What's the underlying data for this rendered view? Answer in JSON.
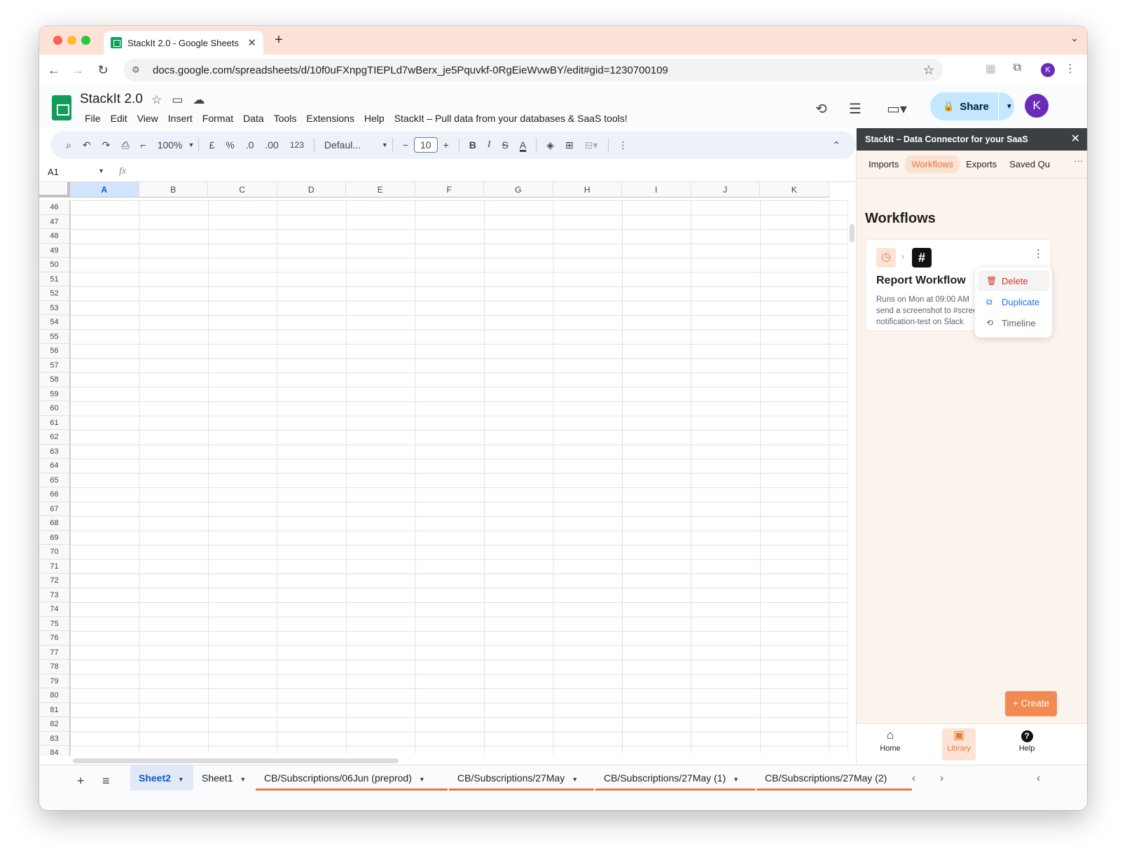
{
  "browser": {
    "tab_title": "StackIt 2.0 - Google Sheets",
    "url": "docs.google.com/spreadsheets/d/10f0uFXnpgTIEPLd7wBerx_je5Pquvkf-0RgEieWvwBY/edit#gid=1230700109",
    "profile_initial": "K"
  },
  "doc": {
    "title": "StackIt 2.0",
    "menu": [
      "File",
      "Edit",
      "View",
      "Insert",
      "Format",
      "Data",
      "Tools",
      "Extensions",
      "Help",
      "StackIt – Pull data from your databases & SaaS tools!"
    ],
    "share_label": "Share",
    "avatar_initial": "K"
  },
  "toolbar": {
    "zoom": "100%",
    "currency": "£",
    "percent": "%",
    "decrease_decimals": ".0",
    "increase_decimals": ".00",
    "number_format": "123",
    "font": "Defaul...",
    "font_size": "10",
    "bold": "B",
    "italic": "I",
    "strike": "S",
    "text_color": "A"
  },
  "formula": {
    "cell_ref": "A1",
    "fx": "fx"
  },
  "grid": {
    "columns": [
      "A",
      "B",
      "C",
      "D",
      "E",
      "F",
      "G",
      "H",
      "I",
      "J",
      "K"
    ],
    "active_column": "A",
    "rows": [
      46,
      47,
      48,
      49,
      50,
      51,
      52,
      53,
      54,
      55,
      56,
      57,
      58,
      59,
      60,
      61,
      62,
      63,
      64,
      65,
      66,
      67,
      68,
      69,
      70,
      71,
      72,
      73,
      74,
      75,
      76,
      77,
      78,
      79,
      80,
      81,
      82,
      83,
      84
    ]
  },
  "sheet_tabs": [
    {
      "label": "Sheet2",
      "active": true,
      "colored": false
    },
    {
      "label": "Sheet1",
      "active": false,
      "colored": false
    },
    {
      "label": "CB/Subscriptions/06Jun (preprod)",
      "active": false,
      "colored": true
    },
    {
      "label": "CB/Subscriptions/27May",
      "active": false,
      "colored": true
    },
    {
      "label": "CB/Subscriptions/27May (1)",
      "active": false,
      "colored": true
    },
    {
      "label": "CB/Subscriptions/27May (2)",
      "active": false,
      "colored": true
    }
  ],
  "panel": {
    "header": "StackIt – Data Connector for your SaaS",
    "tabs": [
      "Imports",
      "Workflows",
      "Exports",
      "Saved Qu"
    ],
    "active_tab": "Workflows",
    "more": "···",
    "title": "Workflows",
    "workflow": {
      "name": "Report Workflow",
      "desc_lines": [
        "Runs on Mon at 09:00 AM",
        "send a screenshot to #scree",
        "notification-test on Slack"
      ]
    },
    "menu": {
      "delete": "Delete",
      "duplicate": "Duplicate",
      "timeline": "Timeline"
    },
    "create_label": "Create",
    "footer": {
      "home": "Home",
      "library": "Library",
      "help": "Help"
    }
  },
  "colors": {
    "accent": "#e8773f",
    "sheets_green": "#0f9d58",
    "share_blue": "#c2e7ff",
    "danger": "#d93025",
    "link_blue": "#1a73e8"
  }
}
